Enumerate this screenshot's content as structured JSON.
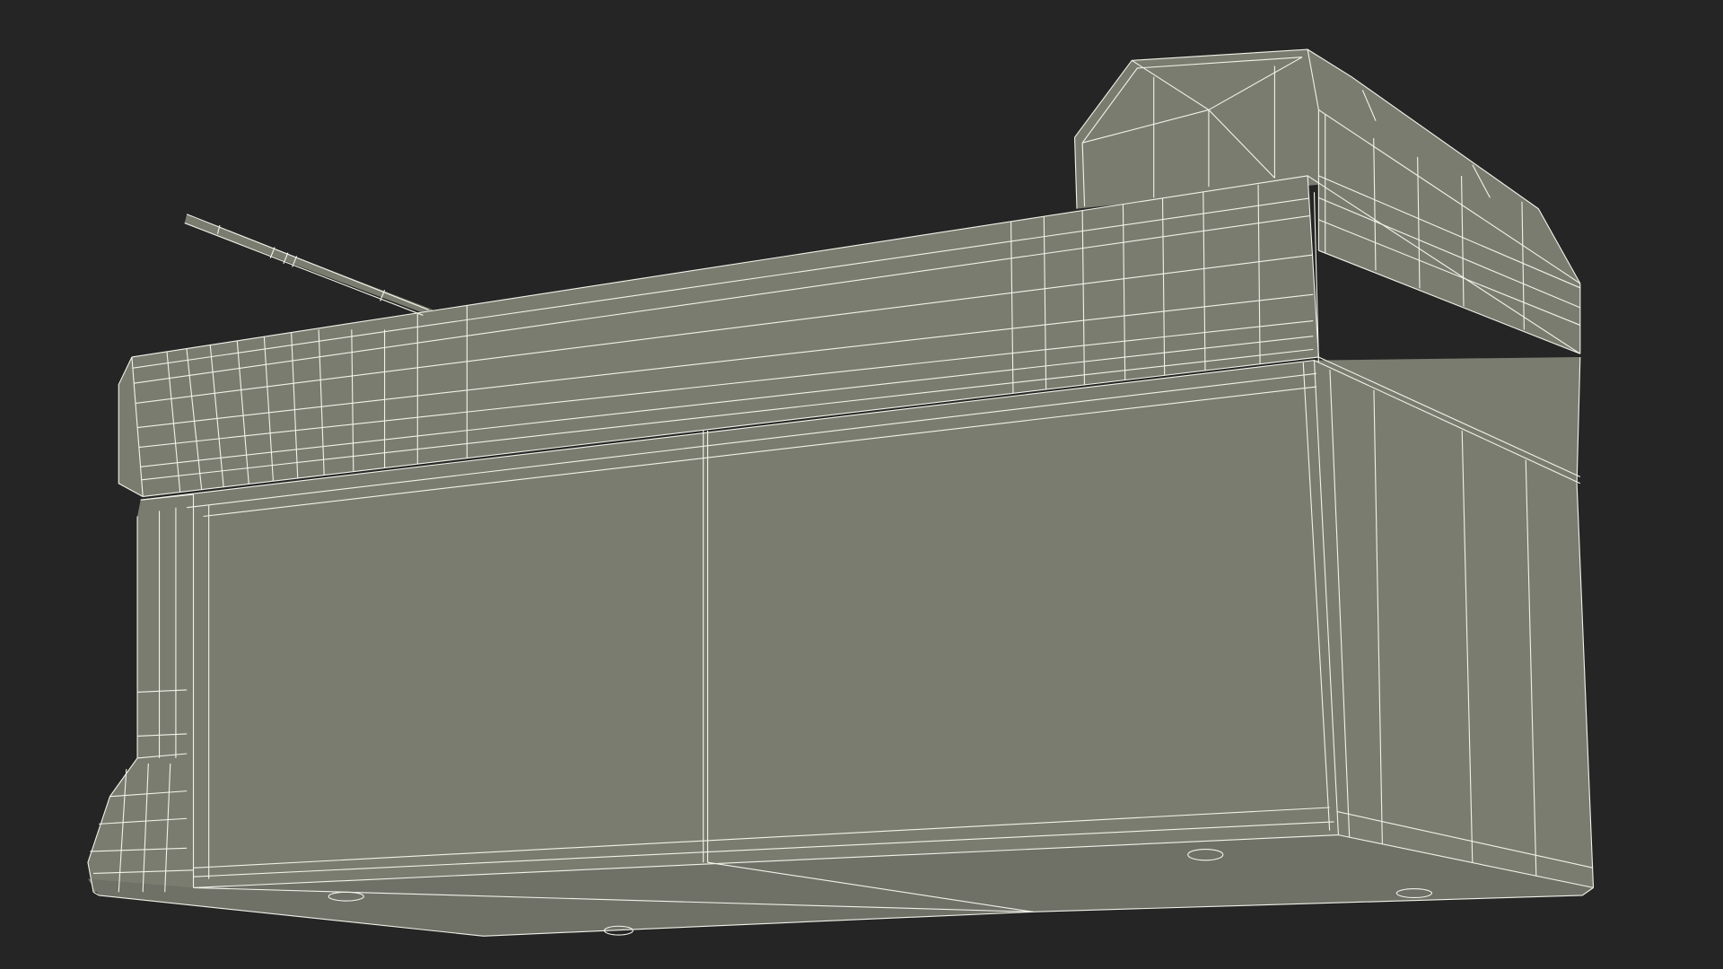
{
  "scene": {
    "background_color": "#252525",
    "surface_color": "#7b7c70",
    "surface_dark_color": "#6f7066",
    "wire_color": "#f2f2ea",
    "render_style": "wireframe-over-shaded"
  }
}
